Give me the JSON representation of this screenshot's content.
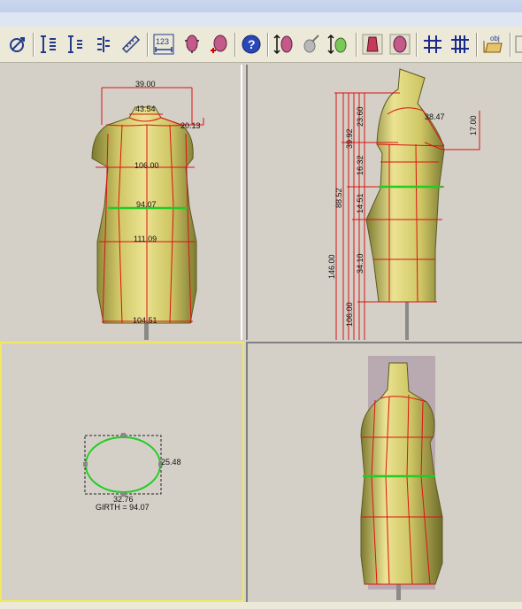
{
  "toolbar": {
    "buttons": [
      {
        "id": "measure-tool",
        "icon": "measure-tool-icon"
      },
      {
        "id": "vertical-line-1",
        "icon": "vertical-ruler-icon"
      },
      {
        "id": "vertical-line-2",
        "icon": "vertical-ruler-2-icon"
      },
      {
        "id": "vertical-line-3",
        "icon": "vertical-ruler-3-icon"
      },
      {
        "id": "ruler",
        "icon": "ruler-icon"
      },
      {
        "id": "numeric-123",
        "label": "123",
        "icon": "numeric-dimension-icon"
      },
      {
        "id": "body-settings-1",
        "icon": "body-settings-icon"
      },
      {
        "id": "body-add",
        "icon": "body-add-icon"
      },
      {
        "id": "help",
        "icon": "help-icon"
      },
      {
        "id": "body-height",
        "icon": "body-height-icon"
      },
      {
        "id": "body-edit",
        "icon": "body-edit-icon"
      },
      {
        "id": "body-scale",
        "icon": "body-scale-icon"
      },
      {
        "id": "body-view-1",
        "icon": "body-view-icon"
      },
      {
        "id": "body-view-2",
        "icon": "body-view-2-icon"
      },
      {
        "id": "grid-1",
        "icon": "grid-icon"
      },
      {
        "id": "grid-2",
        "icon": "grid-bold-icon"
      },
      {
        "id": "open-obj",
        "label": "obj",
        "icon": "open-obj-icon"
      }
    ]
  },
  "front_view": {
    "labels": {
      "shoulder_width": "39.00",
      "neck": "43.54",
      "shoulder": "20.13",
      "bust": "106.00",
      "waist": "94.07",
      "hip": "111.09",
      "hem": "104.51"
    }
  },
  "side_view": {
    "labels": {
      "arm_girth": "38.47",
      "arm_depth": "17.00",
      "upper": "23.60",
      "bust_to_neck": "39.92",
      "bust_height": "16.32",
      "torso": "88.52",
      "waist_seg": "14.51",
      "hip_seg": "34.10",
      "total": "146.00",
      "lower": "106.00"
    }
  },
  "top_view": {
    "labels": {
      "depth": "25.48",
      "width": "32.76",
      "girth": "GIRTH = 94.07"
    }
  },
  "colors": {
    "body_fill": "#d8d070",
    "body_shade": "#8c8a3c",
    "measure_line": "#dd1111",
    "girth_line": "#22cc22",
    "active_pane_border": "#f2e862"
  }
}
